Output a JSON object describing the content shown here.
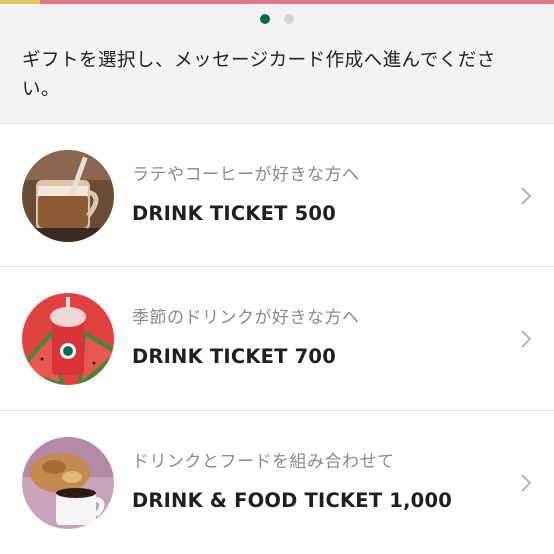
{
  "pager": {
    "pages": 2,
    "active": 0
  },
  "instruction": "ギフトを選択し、メッセージカード作成へ進んでください。",
  "items": [
    {
      "subtitle": "ラテやコーヒーが好きな方へ",
      "title": "DRINK TICKET 500",
      "image": "latte-glass-image"
    },
    {
      "subtitle": "季節のドリンクが好きな方へ",
      "title": "DRINK TICKET 700",
      "image": "watermelon-frappuccino-image"
    },
    {
      "subtitle": "ドリンクとフードを組み合わせて",
      "title": "DRINK & FOOD TICKET 1,000",
      "image": "coffee-and-pastry-image"
    }
  ],
  "colors": {
    "accent_green": "#0a6b4b",
    "top_bar": "#e07a8a"
  }
}
